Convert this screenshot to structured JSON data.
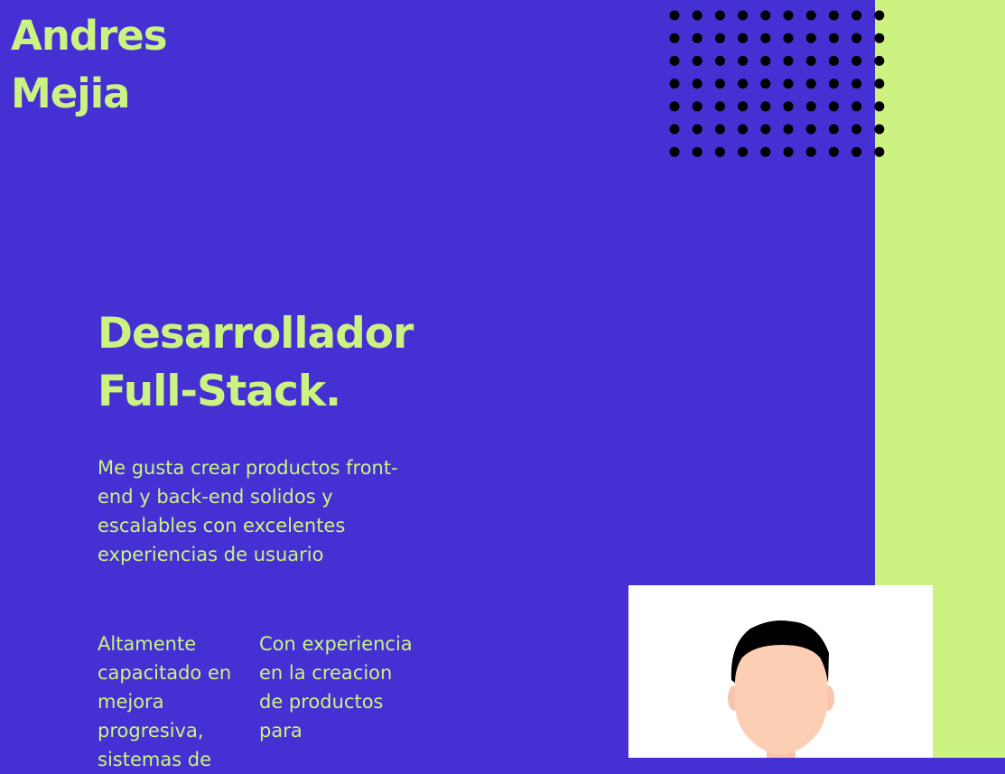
{
  "header": {
    "logo_line1": "Andres",
    "logo_line2": "Mejia"
  },
  "hero": {
    "title_line1": "Desarrollador",
    "title_line2": "Full-Stack.",
    "description": "Me gusta crear productos front-end y back-end solidos y escalables con excelentes experiencias de usuario"
  },
  "features": [
    {
      "text": "Altamente capacitado en mejora progresiva, sistemas de"
    },
    {
      "text": "Con experiencia en la creacion de productos para"
    }
  ],
  "profile": {
    "icon": "avatar-placeholder-icon"
  },
  "decor": {
    "dot_grid_icon": "dot-grid-pattern"
  },
  "colors": {
    "background": "#4530d3",
    "accent": "#ccf381",
    "dots": "#000000",
    "card": "#ffffff"
  }
}
